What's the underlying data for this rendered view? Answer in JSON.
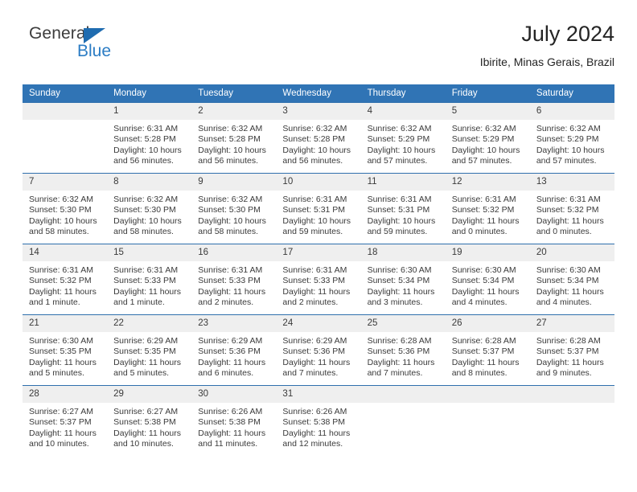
{
  "brand": {
    "word_one": "General",
    "word_two": "Blue",
    "triangle_color": "#1f6cb0",
    "blue_text_color": "#2b7cc4"
  },
  "header": {
    "title": "July 2024",
    "subtitle": "Ibirite, Minas Gerais, Brazil"
  },
  "theme": {
    "header_blue": "#3074b5",
    "rule_blue": "#2f6fad",
    "daynum_gray": "#efefef",
    "text_color": "#3a3a3a"
  },
  "weekday_headers": [
    "Sunday",
    "Monday",
    "Tuesday",
    "Wednesday",
    "Thursday",
    "Friday",
    "Saturday"
  ],
  "labels": {
    "sunrise_prefix": "Sunrise:",
    "sunset_prefix": "Sunset:",
    "daylight_prefix": "Daylight:"
  },
  "weeks": [
    [
      {
        "day": "",
        "sunrise": "",
        "sunset": "",
        "daylight_line1": "",
        "daylight_line2": "",
        "empty": true
      },
      {
        "day": "1",
        "sunrise": "Sunrise: 6:31 AM",
        "sunset": "Sunset: 5:28 PM",
        "daylight_line1": "Daylight: 10 hours",
        "daylight_line2": "and 56 minutes."
      },
      {
        "day": "2",
        "sunrise": "Sunrise: 6:32 AM",
        "sunset": "Sunset: 5:28 PM",
        "daylight_line1": "Daylight: 10 hours",
        "daylight_line2": "and 56 minutes."
      },
      {
        "day": "3",
        "sunrise": "Sunrise: 6:32 AM",
        "sunset": "Sunset: 5:28 PM",
        "daylight_line1": "Daylight: 10 hours",
        "daylight_line2": "and 56 minutes."
      },
      {
        "day": "4",
        "sunrise": "Sunrise: 6:32 AM",
        "sunset": "Sunset: 5:29 PM",
        "daylight_line1": "Daylight: 10 hours",
        "daylight_line2": "and 57 minutes."
      },
      {
        "day": "5",
        "sunrise": "Sunrise: 6:32 AM",
        "sunset": "Sunset: 5:29 PM",
        "daylight_line1": "Daylight: 10 hours",
        "daylight_line2": "and 57 minutes."
      },
      {
        "day": "6",
        "sunrise": "Sunrise: 6:32 AM",
        "sunset": "Sunset: 5:29 PM",
        "daylight_line1": "Daylight: 10 hours",
        "daylight_line2": "and 57 minutes."
      }
    ],
    [
      {
        "day": "7",
        "sunrise": "Sunrise: 6:32 AM",
        "sunset": "Sunset: 5:30 PM",
        "daylight_line1": "Daylight: 10 hours",
        "daylight_line2": "and 58 minutes."
      },
      {
        "day": "8",
        "sunrise": "Sunrise: 6:32 AM",
        "sunset": "Sunset: 5:30 PM",
        "daylight_line1": "Daylight: 10 hours",
        "daylight_line2": "and 58 minutes."
      },
      {
        "day": "9",
        "sunrise": "Sunrise: 6:32 AM",
        "sunset": "Sunset: 5:30 PM",
        "daylight_line1": "Daylight: 10 hours",
        "daylight_line2": "and 58 minutes."
      },
      {
        "day": "10",
        "sunrise": "Sunrise: 6:31 AM",
        "sunset": "Sunset: 5:31 PM",
        "daylight_line1": "Daylight: 10 hours",
        "daylight_line2": "and 59 minutes."
      },
      {
        "day": "11",
        "sunrise": "Sunrise: 6:31 AM",
        "sunset": "Sunset: 5:31 PM",
        "daylight_line1": "Daylight: 10 hours",
        "daylight_line2": "and 59 minutes."
      },
      {
        "day": "12",
        "sunrise": "Sunrise: 6:31 AM",
        "sunset": "Sunset: 5:32 PM",
        "daylight_line1": "Daylight: 11 hours",
        "daylight_line2": "and 0 minutes."
      },
      {
        "day": "13",
        "sunrise": "Sunrise: 6:31 AM",
        "sunset": "Sunset: 5:32 PM",
        "daylight_line1": "Daylight: 11 hours",
        "daylight_line2": "and 0 minutes."
      }
    ],
    [
      {
        "day": "14",
        "sunrise": "Sunrise: 6:31 AM",
        "sunset": "Sunset: 5:32 PM",
        "daylight_line1": "Daylight: 11 hours",
        "daylight_line2": "and 1 minute."
      },
      {
        "day": "15",
        "sunrise": "Sunrise: 6:31 AM",
        "sunset": "Sunset: 5:33 PM",
        "daylight_line1": "Daylight: 11 hours",
        "daylight_line2": "and 1 minute."
      },
      {
        "day": "16",
        "sunrise": "Sunrise: 6:31 AM",
        "sunset": "Sunset: 5:33 PM",
        "daylight_line1": "Daylight: 11 hours",
        "daylight_line2": "and 2 minutes."
      },
      {
        "day": "17",
        "sunrise": "Sunrise: 6:31 AM",
        "sunset": "Sunset: 5:33 PM",
        "daylight_line1": "Daylight: 11 hours",
        "daylight_line2": "and 2 minutes."
      },
      {
        "day": "18",
        "sunrise": "Sunrise: 6:30 AM",
        "sunset": "Sunset: 5:34 PM",
        "daylight_line1": "Daylight: 11 hours",
        "daylight_line2": "and 3 minutes."
      },
      {
        "day": "19",
        "sunrise": "Sunrise: 6:30 AM",
        "sunset": "Sunset: 5:34 PM",
        "daylight_line1": "Daylight: 11 hours",
        "daylight_line2": "and 4 minutes."
      },
      {
        "day": "20",
        "sunrise": "Sunrise: 6:30 AM",
        "sunset": "Sunset: 5:34 PM",
        "daylight_line1": "Daylight: 11 hours",
        "daylight_line2": "and 4 minutes."
      }
    ],
    [
      {
        "day": "21",
        "sunrise": "Sunrise: 6:30 AM",
        "sunset": "Sunset: 5:35 PM",
        "daylight_line1": "Daylight: 11 hours",
        "daylight_line2": "and 5 minutes."
      },
      {
        "day": "22",
        "sunrise": "Sunrise: 6:29 AM",
        "sunset": "Sunset: 5:35 PM",
        "daylight_line1": "Daylight: 11 hours",
        "daylight_line2": "and 5 minutes."
      },
      {
        "day": "23",
        "sunrise": "Sunrise: 6:29 AM",
        "sunset": "Sunset: 5:36 PM",
        "daylight_line1": "Daylight: 11 hours",
        "daylight_line2": "and 6 minutes."
      },
      {
        "day": "24",
        "sunrise": "Sunrise: 6:29 AM",
        "sunset": "Sunset: 5:36 PM",
        "daylight_line1": "Daylight: 11 hours",
        "daylight_line2": "and 7 minutes."
      },
      {
        "day": "25",
        "sunrise": "Sunrise: 6:28 AM",
        "sunset": "Sunset: 5:36 PM",
        "daylight_line1": "Daylight: 11 hours",
        "daylight_line2": "and 7 minutes."
      },
      {
        "day": "26",
        "sunrise": "Sunrise: 6:28 AM",
        "sunset": "Sunset: 5:37 PM",
        "daylight_line1": "Daylight: 11 hours",
        "daylight_line2": "and 8 minutes."
      },
      {
        "day": "27",
        "sunrise": "Sunrise: 6:28 AM",
        "sunset": "Sunset: 5:37 PM",
        "daylight_line1": "Daylight: 11 hours",
        "daylight_line2": "and 9 minutes."
      }
    ],
    [
      {
        "day": "28",
        "sunrise": "Sunrise: 6:27 AM",
        "sunset": "Sunset: 5:37 PM",
        "daylight_line1": "Daylight: 11 hours",
        "daylight_line2": "and 10 minutes."
      },
      {
        "day": "29",
        "sunrise": "Sunrise: 6:27 AM",
        "sunset": "Sunset: 5:38 PM",
        "daylight_line1": "Daylight: 11 hours",
        "daylight_line2": "and 10 minutes."
      },
      {
        "day": "30",
        "sunrise": "Sunrise: 6:26 AM",
        "sunset": "Sunset: 5:38 PM",
        "daylight_line1": "Daylight: 11 hours",
        "daylight_line2": "and 11 minutes."
      },
      {
        "day": "31",
        "sunrise": "Sunrise: 6:26 AM",
        "sunset": "Sunset: 5:38 PM",
        "daylight_line1": "Daylight: 11 hours",
        "daylight_line2": "and 12 minutes."
      },
      {
        "day": "",
        "sunrise": "",
        "sunset": "",
        "daylight_line1": "",
        "daylight_line2": "",
        "empty": true
      },
      {
        "day": "",
        "sunrise": "",
        "sunset": "",
        "daylight_line1": "",
        "daylight_line2": "",
        "empty": true
      },
      {
        "day": "",
        "sunrise": "",
        "sunset": "",
        "daylight_line1": "",
        "daylight_line2": "",
        "empty": true
      }
    ]
  ]
}
